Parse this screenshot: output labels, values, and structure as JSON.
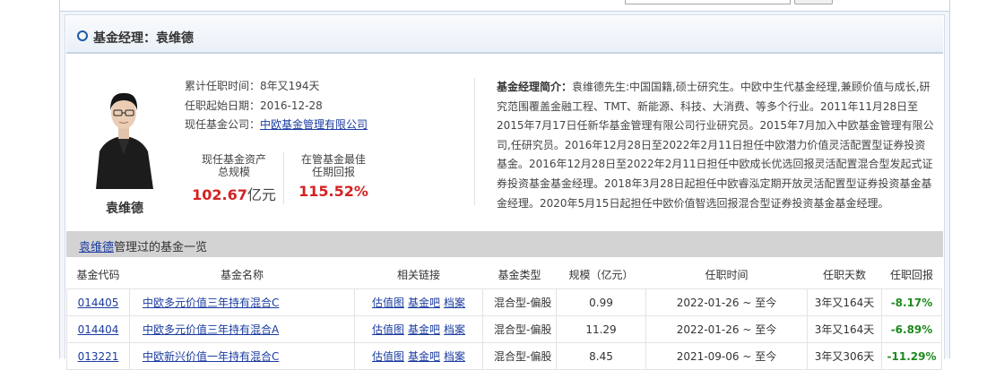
{
  "header": {
    "title": "基金经理：袁维德"
  },
  "manager": {
    "name": "袁维德",
    "tenure_label": "累计任职时间：",
    "tenure_value": "8年又194天",
    "start_label": "任职起始日期：",
    "start_value": "2016-12-28",
    "company_label": "现任基金公司：",
    "company_value": "中欧基金管理有限公司",
    "aum_label_1": "现任基金资产",
    "aum_label_2": "总规模",
    "aum_value": "102.67",
    "aum_unit": "亿元",
    "best_label_1": "在管基金最佳",
    "best_label_2": "任期回报",
    "best_value": "115.52%"
  },
  "bio": {
    "label": "基金经理简介：",
    "text": "袁维德先生:中国国籍,硕士研究生。中欧中生代基金经理,兼顾价值与成长,研究范围覆盖金融工程、TMT、新能源、科技、大消费、等多个行业。2011年11月28日至2015年7月17日任新华基金管理有限公司行业研究员。2015年7月加入中欧基金管理有限公司,任研究员。2016年12月28日至2022年2月11日担任中欧潜力价值灵活配置型证券投资基金。2016年12月28日至2022年2月11日担任中欧成长优选回报灵活配置混合型发起式证券投资基金基金经理。2018年3月28日起担任中欧睿泓定期开放灵活配置型证券投资基金基金经理。2020年5月15日起担任中欧价值智选回报混合型证券投资基金基金经理。"
  },
  "list": {
    "manager_link": "袁维德",
    "suffix": "管理过的基金一览",
    "columns": [
      "基金代码",
      "基金名称",
      "相关链接",
      "基金类型",
      "规模（亿元）",
      "任职时间",
      "任职天数",
      "任职回报"
    ],
    "link_labels": [
      "估值图",
      "基金吧",
      "档案"
    ],
    "rows": [
      {
        "code": "014405",
        "name": "中欧多元价值三年持有混合C",
        "type": "混合型-偏股",
        "size": "0.99",
        "period": "2022-01-26 ~ 至今",
        "days": "3年又164天",
        "ret": "-8.17%"
      },
      {
        "code": "014404",
        "name": "中欧多元价值三年持有混合A",
        "type": "混合型-偏股",
        "size": "11.29",
        "period": "2022-01-26 ~ 至今",
        "days": "3年又164天",
        "ret": "-6.89%"
      },
      {
        "code": "013221",
        "name": "中欧新兴价值一年持有混合C",
        "type": "混合型-偏股",
        "size": "8.45",
        "period": "2021-09-06 ~ 至今",
        "days": "3年又306天",
        "ret": "-11.29%"
      }
    ]
  },
  "colors": {
    "accent": "#1b5aa6",
    "link": "#1b3ca0",
    "negative": "#1e8a1e",
    "highlight": "#d42222"
  }
}
